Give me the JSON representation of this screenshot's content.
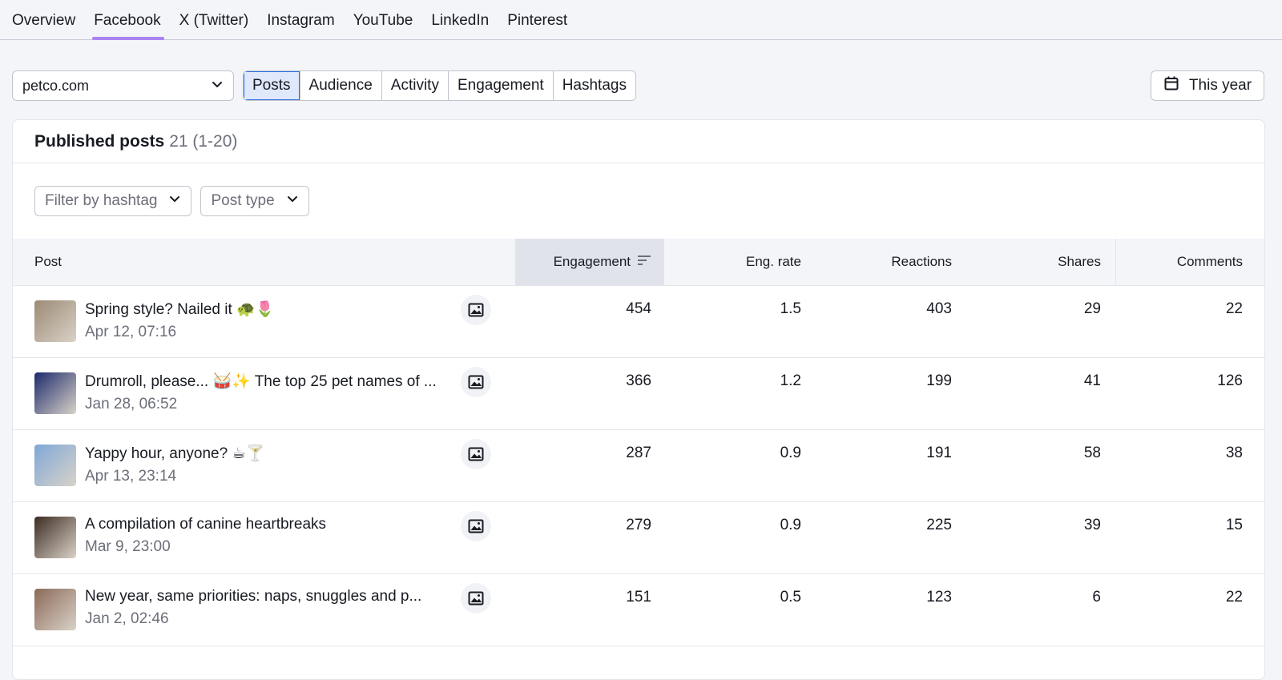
{
  "network_tabs": [
    {
      "label": "Overview",
      "active": false
    },
    {
      "label": "Facebook",
      "active": true
    },
    {
      "label": "X (Twitter)",
      "active": false
    },
    {
      "label": "Instagram",
      "active": false
    },
    {
      "label": "YouTube",
      "active": false
    },
    {
      "label": "LinkedIn",
      "active": false
    },
    {
      "label": "Pinterest",
      "active": false
    }
  ],
  "domain_select": {
    "value": "petco.com"
  },
  "section_tabs": [
    {
      "label": "Posts",
      "active": true
    },
    {
      "label": "Audience",
      "active": false
    },
    {
      "label": "Activity",
      "active": false
    },
    {
      "label": "Engagement",
      "active": false
    },
    {
      "label": "Hashtags",
      "active": false
    }
  ],
  "date_range": {
    "label": "This year"
  },
  "card": {
    "title": "Published posts",
    "count": "21 (1-20)"
  },
  "filters": {
    "hashtag_placeholder": "Filter by hashtag",
    "post_type_placeholder": "Post type"
  },
  "table": {
    "columns": {
      "post": "Post",
      "engagement": "Engagement",
      "eng_rate": "Eng. rate",
      "reactions": "Reactions",
      "shares": "Shares",
      "comments": "Comments"
    },
    "rows": [
      {
        "title": "Spring style? Nailed it 🐢🌷",
        "date": "Apr 12, 07:16",
        "engagement": "454",
        "eng_rate": "1.5",
        "reactions": "403",
        "shares": "29",
        "comments": "22",
        "thumb_color": "#9c8a74"
      },
      {
        "title": "Drumroll, please... 🥁✨ The top 25 pet names of ...",
        "date": "Jan 28, 06:52",
        "engagement": "366",
        "eng_rate": "1.2",
        "reactions": "199",
        "shares": "41",
        "comments": "126",
        "thumb_color": "#1c2a6b"
      },
      {
        "title": "Yappy hour, anyone? ☕🍸",
        "date": "Apr 13, 23:14",
        "engagement": "287",
        "eng_rate": "0.9",
        "reactions": "191",
        "shares": "58",
        "comments": "38",
        "thumb_color": "#7fa8d8"
      },
      {
        "title": "A compilation of canine heartbreaks",
        "date": "Mar 9, 23:00",
        "engagement": "279",
        "eng_rate": "0.9",
        "reactions": "225",
        "shares": "39",
        "comments": "15",
        "thumb_color": "#3d2c22"
      },
      {
        "title": "New year, same priorities: naps, snuggles and p...",
        "date": "Jan 2, 02:46",
        "engagement": "151",
        "eng_rate": "0.5",
        "reactions": "123",
        "shares": "6",
        "comments": "22",
        "thumb_color": "#8b6a58"
      }
    ]
  },
  "colors": {
    "accent_tab_underline": "#a984f2",
    "active_segment_bg": "#dfe9fb",
    "active_segment_border": "#2b6fd9"
  },
  "icons": {
    "chevron": "chevron-down-icon",
    "calendar": "calendar-icon",
    "sort": "sort-icon",
    "post_type": "image-icon"
  }
}
